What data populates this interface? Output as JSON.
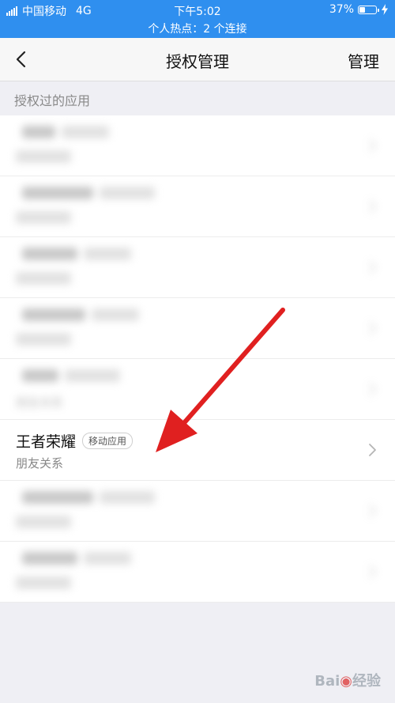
{
  "status_bar": {
    "carrier": "中国移动",
    "network": "4G",
    "time": "下午5:02",
    "battery": "37%",
    "battery_level": 0.37,
    "hotspot": "个人热点：2 个连接"
  },
  "nav": {
    "title": "授权管理",
    "action": "管理",
    "back_icon": "chevron-left-icon"
  },
  "section_label": "授权过的应用",
  "apps": [
    {
      "name": "",
      "badge": "",
      "sub": "",
      "blurred": true
    },
    {
      "name": "",
      "badge": "",
      "sub": "",
      "blurred": true
    },
    {
      "name": "",
      "badge": "",
      "sub": "",
      "blurred": true
    },
    {
      "name": "",
      "badge": "",
      "sub": "",
      "blurred": true
    },
    {
      "name": "",
      "badge": "",
      "sub": "朋友关系",
      "blurred": true
    },
    {
      "name": "王者荣耀",
      "badge": "移动应用",
      "sub": "朋友关系",
      "blurred": false
    },
    {
      "name": "",
      "badge": "",
      "sub": "",
      "blurred": true
    },
    {
      "name": "",
      "badge": "",
      "sub": "",
      "blurred": true
    }
  ],
  "colors": {
    "status_bar": "#2f8fef",
    "arrow": "#e02020"
  },
  "watermark": "Baidu 经验"
}
